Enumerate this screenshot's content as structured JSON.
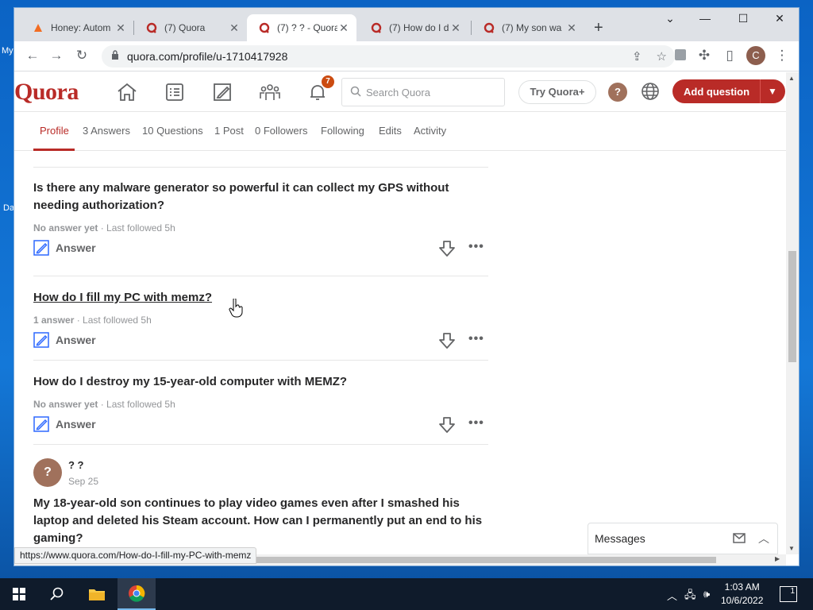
{
  "desktop": {
    "labels": [
      "My",
      "Da"
    ]
  },
  "browser": {
    "tabs": [
      {
        "title": "Honey: Autom",
        "icon": "honey-icon"
      },
      {
        "title": "(7) Quora",
        "icon": "quora-icon"
      },
      {
        "title": "(7) ? ? - Quora",
        "icon": "quora-icon",
        "active": true
      },
      {
        "title": "(7) How do I d",
        "icon": "quora-icon"
      },
      {
        "title": "(7) My son wa",
        "icon": "quora-icon"
      }
    ],
    "url": "quora.com/profile/u-1710417928",
    "profile_initial": "C",
    "status_url": "https://www.quora.com/How-do-I-fill-my-PC-with-memz"
  },
  "quora": {
    "logo": "Quora",
    "notification_count": "7",
    "search_placeholder": "Search Quora",
    "try_plus": "Try Quora+",
    "add_question": "Add question",
    "brand_color": "#b92b27"
  },
  "profile_tabs": [
    {
      "label": "Profile",
      "active": true
    },
    {
      "label": "3 Answers"
    },
    {
      "label": "10 Questions"
    },
    {
      "label": "1 Post"
    },
    {
      "label": "0 Followers"
    },
    {
      "label": "Following"
    },
    {
      "label": "Edits"
    },
    {
      "label": "Activity"
    }
  ],
  "questions": [
    {
      "title": "Is there any malware generator so powerful it can collect my GPS without needing authorization?",
      "answers": "No answer yet",
      "followed": "· Last followed 5h",
      "action": "Answer"
    },
    {
      "title": "How do I fill my PC with memz?",
      "answers": "1 answer",
      "followed": "· Last followed 5h",
      "action": "Answer"
    },
    {
      "title": "How do I destroy my 15-year-old computer with MEMZ?",
      "answers": "No answer yet",
      "followed": "· Last followed 5h",
      "action": "Answer"
    }
  ],
  "post": {
    "avatar": "?",
    "author": "? ?",
    "date": "Sep 25",
    "title": "My 18-year-old son continues to play video games even after I smashed his laptop and deleted his Steam account. How can I permanently put an end to his gaming?"
  },
  "messages": {
    "label": "Messages"
  },
  "taskbar": {
    "time": "1:03 AM",
    "date": "10/6/2022",
    "notifications": "1"
  }
}
